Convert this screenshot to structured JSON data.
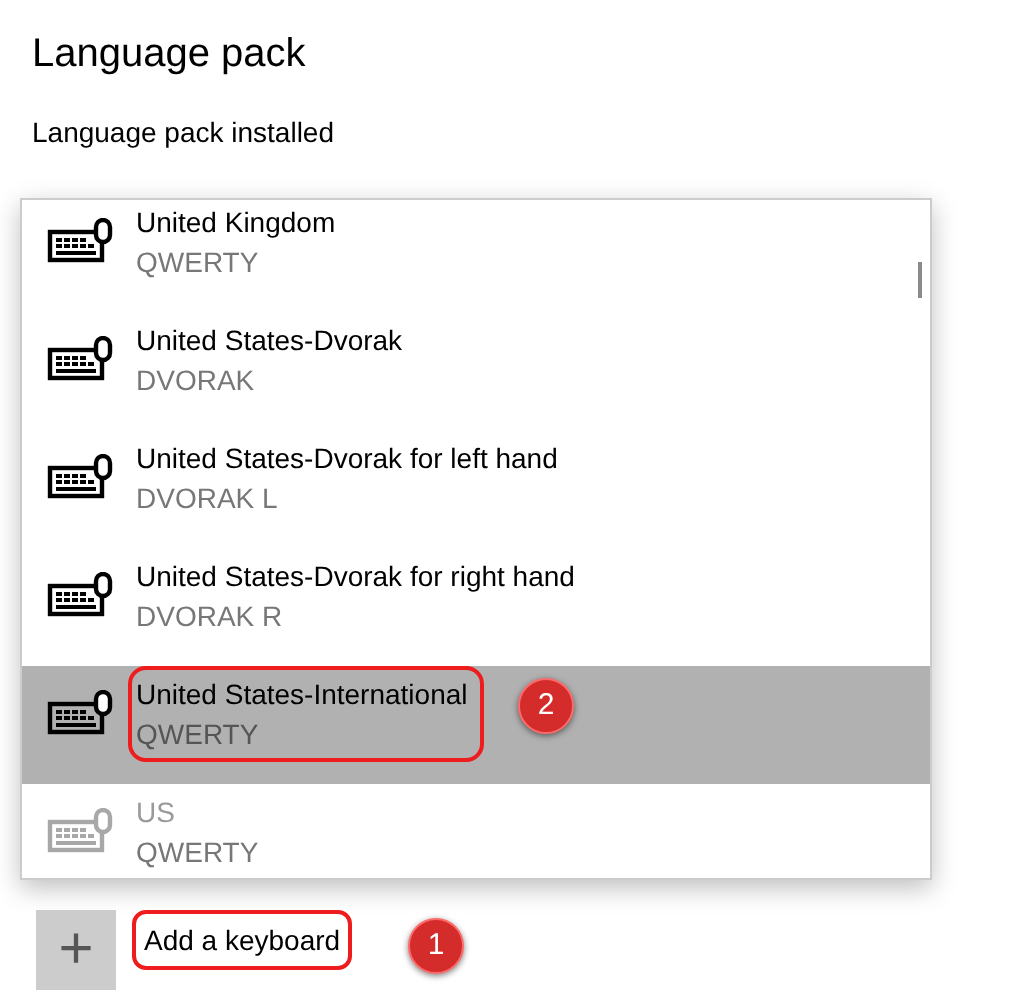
{
  "heading": "Language pack",
  "status": "Language pack installed",
  "keyboards": [
    {
      "name": "United Kingdom",
      "layout": "QWERTY",
      "selected": false,
      "disabled": false
    },
    {
      "name": "United States-Dvorak",
      "layout": "DVORAK",
      "selected": false,
      "disabled": false
    },
    {
      "name": "United States-Dvorak for left hand",
      "layout": "DVORAK L",
      "selected": false,
      "disabled": false
    },
    {
      "name": "United States-Dvorak for right hand",
      "layout": "DVORAK R",
      "selected": false,
      "disabled": false
    },
    {
      "name": "United States-International",
      "layout": "QWERTY",
      "selected": true,
      "disabled": false,
      "annotation": "2"
    },
    {
      "name": "US",
      "layout": "QWERTY",
      "selected": false,
      "disabled": true
    }
  ],
  "add_keyboard": {
    "label": "Add a keyboard",
    "plus": "+",
    "annotation": "1"
  }
}
